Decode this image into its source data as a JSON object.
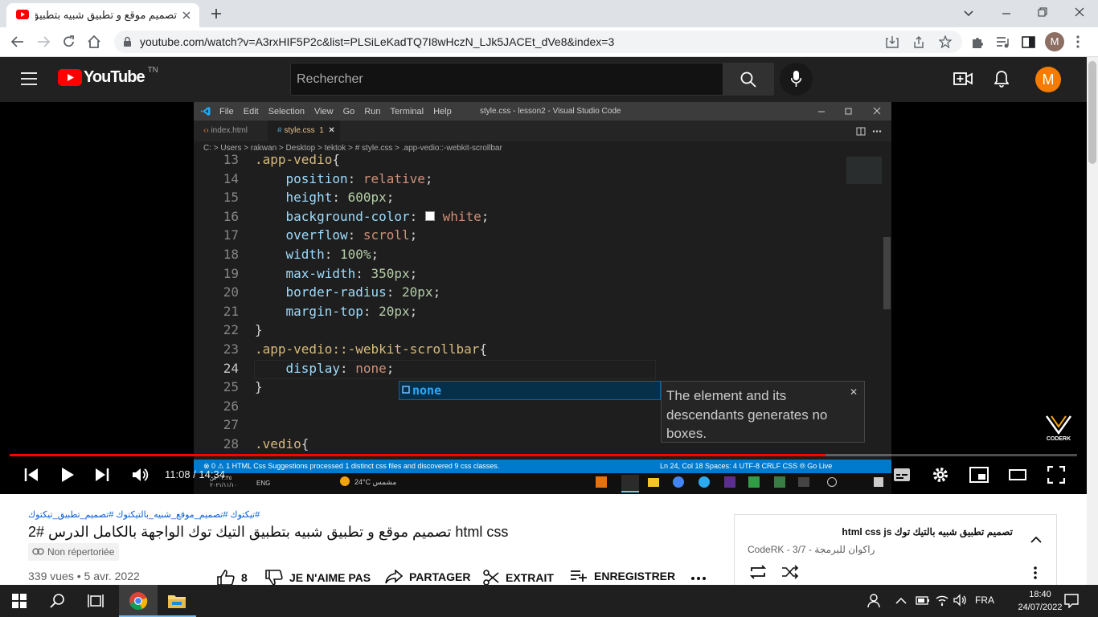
{
  "browser": {
    "tab_title": "تصميم موقع و تطبيق شبيه بتطبيق",
    "url": "youtube.com/watch?v=A3rxHIF5P2c&list=PLSiLeKadTQ7I8wHczN_LJk5JACEt_dVe8&index=3",
    "profile_initial": "M"
  },
  "youtube": {
    "logo_text": "YouTube",
    "country_code": "TN",
    "search_placeholder": "Rechercher",
    "avatar_initial": "M"
  },
  "vscode": {
    "menu": [
      "File",
      "Edit",
      "Selection",
      "View",
      "Go",
      "Run",
      "Terminal",
      "Help"
    ],
    "window_title": "style.css - lesson2 - Visual Studio Code",
    "tabs": [
      "index.html",
      "style.css"
    ],
    "tab_badge": "1",
    "breadcrumb": "C: > Users > rakwan > Desktop > tektok > # style.css > .app-vedio::-webkit-scrollbar",
    "suggestion": "none",
    "suggestion_detail": "The element and its descendants generates no boxes.",
    "status_left": "⊗ 0 ⚠ 1   HTML Css Suggestions processed 1 distinct css files and discovered 9 css classes.",
    "status_right": "Ln 24, Col 18   Spaces: 4   UTF-8   CRLF   CSS   ⦾ Go Live",
    "taskbar_weather": "24°C  مشمس",
    "taskbar_lang": "ENG",
    "taskbar_time": "٠٣:٣٥ ص",
    "taskbar_date": "٢٠٢١/١١/١٠"
  },
  "code_lines": [
    {
      "n": "13",
      "html": "<span class=\"sel\">.app-vedio</span>{"
    },
    {
      "n": "14",
      "html": "    <span class=\"prop\">position</span>: <span class=\"val\">relative</span>;"
    },
    {
      "n": "15",
      "html": "    <span class=\"prop\">height</span>: <span class=\"num\">600px</span>;"
    },
    {
      "n": "16",
      "html": "    <span class=\"prop\">background-color</span>: <span style=\"display:inline-block;width:12px;height:12px;background:#fff;border:1px solid #999\"></span> <span class=\"val\">white</span>;"
    },
    {
      "n": "17",
      "html": "    <span class=\"prop\">overflow</span>: <span class=\"val\">scroll</span>;"
    },
    {
      "n": "18",
      "html": "    <span class=\"prop\">width</span>: <span class=\"num\">100%</span>;"
    },
    {
      "n": "19",
      "html": "    <span class=\"prop\">max-width</span>: <span class=\"num\">350px</span>;"
    },
    {
      "n": "20",
      "html": "    <span class=\"prop\">border-radius</span>: <span class=\"num\">20px</span>;"
    },
    {
      "n": "21",
      "html": "    <span class=\"prop\">margin-top</span>: <span class=\"num\">20px</span>;"
    },
    {
      "n": "22",
      "html": "}"
    },
    {
      "n": "23",
      "html": "<span class=\"sel\">.app-vedio::-webkit-scrollbar</span>{"
    },
    {
      "n": "24",
      "html": "    <span class=\"prop\">display</span>: <span class=\"val\">none</span>;"
    },
    {
      "n": "25",
      "html": "}"
    },
    {
      "n": "26",
      "html": ""
    },
    {
      "n": "27",
      "html": ""
    },
    {
      "n": "28",
      "html": "<span class=\"sel\">.vedio</span>{"
    }
  ],
  "player": {
    "current_time": "11:08",
    "duration": "14:34",
    "time_display": "11:08 / 14:34",
    "progress_fraction": 0.764,
    "watermark": "CODERK"
  },
  "video_info": {
    "hashtags": "#تيكتوك #تصميم_موقع_شبيه_بالتيكتوك #تصميم_تطبيق_تيكتوك",
    "title": "تصميم موقع و تطبيق شبيه بتطبيق التيك توك الواجهة بالكامل الدرس #2 html css",
    "visibility": "Non répertoriée",
    "views": "339 vues",
    "date": "5 avr. 2022",
    "likes": "8",
    "dislike": "JE N'AIME PAS",
    "share": "PARTAGER",
    "clip": "EXTRAIT",
    "save": "ENREGISTRER"
  },
  "playlist": {
    "title": "تصميم تطبيق شبيه بالتيك توك html css js",
    "channel": "CodeRK - راكوان للبرمجة",
    "position": "3/7"
  },
  "taskbar": {
    "lang": "FRA",
    "time": "18:40",
    "date": "24/07/2022"
  },
  "colors": {
    "youtube_red": "#ff0000",
    "vscode_blue": "#007acc",
    "avatar_orange": "#f57c00"
  }
}
